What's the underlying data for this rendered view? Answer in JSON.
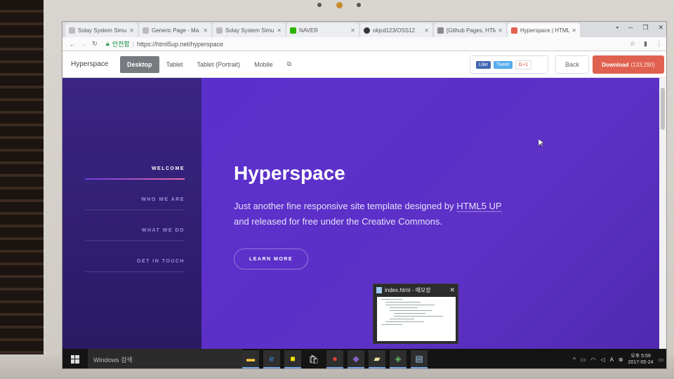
{
  "browser": {
    "tabs": [
      {
        "title": "Solay System Simu",
        "active": false
      },
      {
        "title": "Generic Page - Ma",
        "active": false
      },
      {
        "title": "Solay System Simu",
        "active": false
      },
      {
        "title": "NAVER",
        "active": false
      },
      {
        "title": "okjcd123/OSS12",
        "active": false
      },
      {
        "title": "[Github Pages, HTM",
        "active": false
      },
      {
        "title": "Hyperspace | HTML",
        "active": true
      }
    ],
    "secure_label": "안전함",
    "url": "https://html5up.net/hyperspace"
  },
  "preview_bar": {
    "brand": "Hyperspace",
    "views": [
      "Desktop",
      "Tablet",
      "Tablet (Portrait)",
      "Mobile"
    ],
    "active_view": "Desktop",
    "like": "Like",
    "tweet": "Tweet",
    "gplus": "G+1",
    "back": "Back",
    "download": "Download",
    "download_count": "(133,290)"
  },
  "site": {
    "nav": [
      {
        "label": "WELCOME",
        "active": true
      },
      {
        "label": "WHO WE ARE",
        "active": false
      },
      {
        "label": "WHAT WE DO",
        "active": false
      },
      {
        "label": "GET IN TOUCH",
        "active": false
      }
    ],
    "hero_title": "Hyperspace",
    "hero_text_1": "Just another fine responsive site template designed by ",
    "hero_link": "HTML5 UP",
    "hero_text_2": "and released for free under the Creative Commons.",
    "learn_more": "LEARN MORE"
  },
  "taskbar": {
    "search": "Windows 검색",
    "preview_title": "index.html - 메모장",
    "time_period": "오후 5:59",
    "date": "2017-05-24"
  },
  "colors": {
    "accent_purple": "#5a2fc4",
    "sidebar": "#2e1e72",
    "download": "#e0614f"
  }
}
